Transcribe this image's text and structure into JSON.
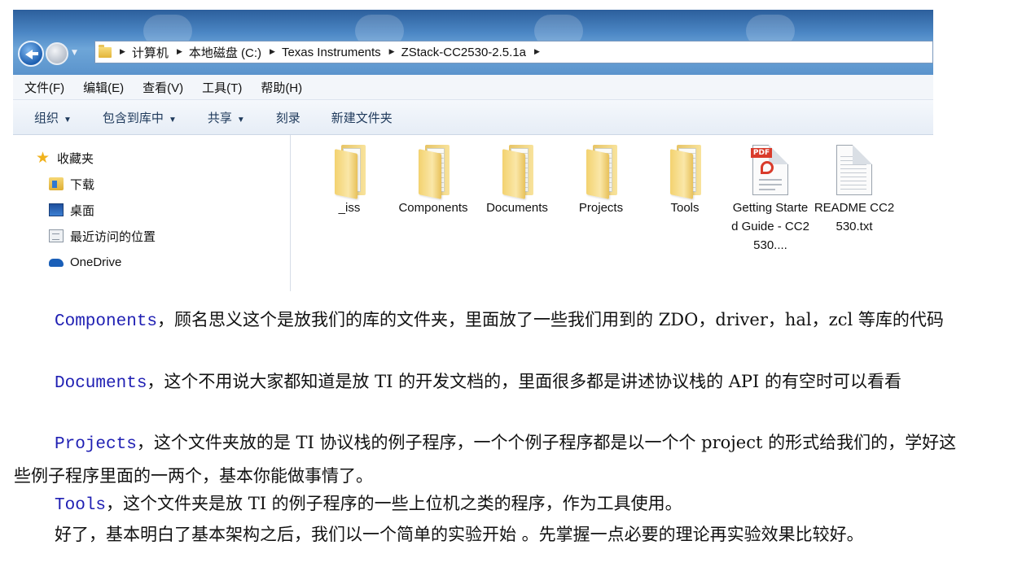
{
  "window": {
    "breadcrumb": [
      "计算机",
      "本地磁盘 (C:)",
      "Texas Instruments",
      "ZStack-CC2530-2.5.1a"
    ],
    "menu": [
      "文件(F)",
      "编辑(E)",
      "查看(V)",
      "工具(T)",
      "帮助(H)"
    ],
    "toolbar": [
      "组织",
      "包含到库中",
      "共享",
      "刻录",
      "新建文件夹"
    ],
    "nav": [
      {
        "label": "收藏夹",
        "icon": "star-icon"
      },
      {
        "label": "下载",
        "icon": "download-folder-icon"
      },
      {
        "label": "桌面",
        "icon": "desktop-icon"
      },
      {
        "label": "最近访问的位置",
        "icon": "recent-places-icon"
      },
      {
        "label": "OneDrive",
        "icon": "onedrive-icon"
      }
    ],
    "files": [
      {
        "name": "_iss",
        "type": "folder"
      },
      {
        "name": "Components",
        "type": "folder"
      },
      {
        "name": "Documents",
        "type": "folder"
      },
      {
        "name": "Projects",
        "type": "folder"
      },
      {
        "name": "Tools",
        "type": "folder"
      },
      {
        "name": "Getting Started Guide - CC2530....",
        "type": "pdf"
      },
      {
        "name": "README CC2530.txt",
        "type": "txt"
      }
    ]
  },
  "article": {
    "p1_kw": "Components",
    "p1_text": "，顾名思义这个是放我们的库的文件夹，里面放了一些我们用到的 ZDO，driver，hal，zcl 等库的代码",
    "p2_kw": "Documents",
    "p2_text": "，这个不用说大家都知道是放 TI 的开发文档的，里面很多都是讲述协议栈的 API 的有空时可以看看",
    "p3_kw": "Projects",
    "p3_text": "，这个文件夹放的是 TI 协议栈的例子程序，一个个例子程序都是以一个个 project 的形式给我们的，学好这些例子程序里面的一两个，基本你能做事情了。",
    "p4_kw": "Tools",
    "p4_text": "，这个文件夹是放 TI 的例子程序的一些上位机之类的程序，作为工具使用。",
    "p5_text": "好了，基本明白了基本架构之后，我们以一个简单的实验开始 。先掌握一点必要的理论再实验效果比较好。"
  }
}
